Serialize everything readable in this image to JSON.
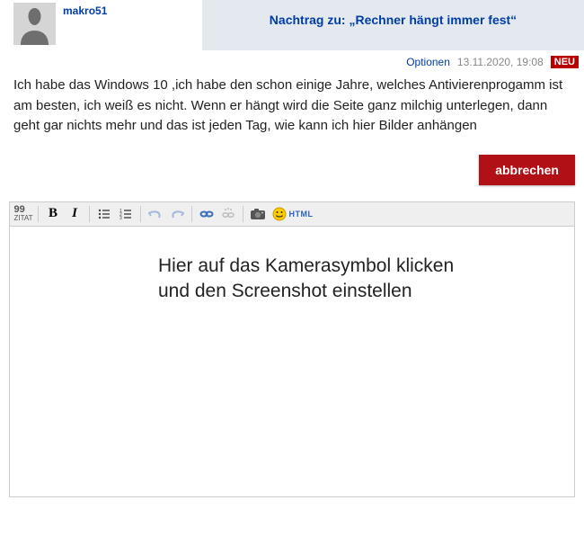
{
  "author": {
    "username": "makro51"
  },
  "post": {
    "title": "Nachtrag zu: „Rechner hängt immer fest“",
    "options_label": "Optionen",
    "timestamp": "13.11.2020, 19:08",
    "new_badge": "NEU",
    "body": "Ich habe das Windows 10 ,ich habe den schon einige Jahre, welches Antivierenprogamm ist am besten, ich weiß es nicht. Wenn er hängt wird die Seite ganz milchig unterlegen, dann geht gar nichts mehr und das ist jeden Tag, wie kann ich hier Bilder anhängen"
  },
  "actions": {
    "cancel": "abbrechen"
  },
  "editor": {
    "hint_line1": "Hier auf das Kamerasymbol klicken",
    "hint_line2": "und den Screenshot einstellen",
    "toolbar": {
      "quote": "ZITAT",
      "bold": "B",
      "italic": "I",
      "html": "HTML"
    }
  }
}
